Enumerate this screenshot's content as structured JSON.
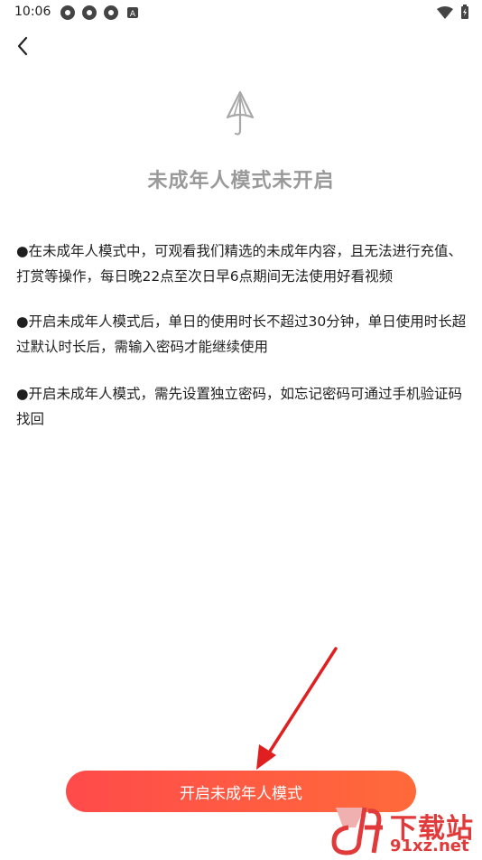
{
  "status_bar": {
    "time": "10:06",
    "left_icons": [
      "app-icon",
      "app-icon",
      "app-icon",
      "a-icon"
    ],
    "right_icons": [
      "wifi-icon",
      "battery-icon"
    ]
  },
  "header": {
    "back_icon": "chevron-left-icon"
  },
  "main": {
    "hero_icon": "umbrella-icon",
    "title": "未成年人模式未开启",
    "rules": [
      {
        "bullet": "●",
        "text": "在未成年人模式中，可观看我们精选的未成年内容，且无法进行充值、打赏等操作，每日晚22点至次日早6点期间无法使用好看视频"
      },
      {
        "bullet": "●",
        "text": "开启未成年人模式后，单日的使用时长不超过30分钟，单日使用时长超过默认时长后，需输入密码才能继续使用"
      },
      {
        "bullet": "●",
        "text": "开启未成年人模式，需先设置独立密码，如忘记密码可通过手机验证码找回"
      }
    ],
    "cta_label": "开启未成年人模式"
  },
  "annotation": {
    "arrow_color": "#e02020"
  },
  "watermark": {
    "logo_text": "9f",
    "title": "下载站",
    "url": "91xz.net",
    "color": "#e03a3a"
  },
  "colors": {
    "accent_start": "#ff4b4b",
    "accent_end": "#ff6a3a",
    "title_gray": "#9a9a9a"
  }
}
